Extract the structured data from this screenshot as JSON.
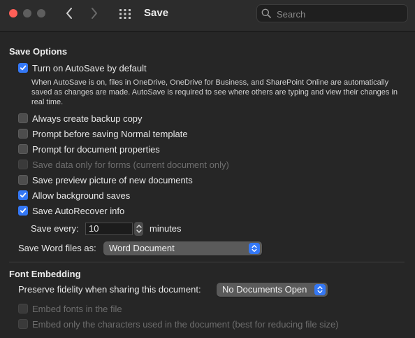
{
  "window": {
    "title": "Save",
    "search_placeholder": "Search"
  },
  "save_options": {
    "heading": "Save Options",
    "autosave": {
      "label": "Turn on AutoSave by default",
      "checked": true,
      "description": "When AutoSave is on, files in OneDrive, OneDrive for Business, and SharePoint Online are automatically saved as changes are made. AutoSave is required to see where others are typing and view their changes in real time."
    },
    "options": [
      {
        "label": "Always create backup copy",
        "checked": false,
        "enabled": true
      },
      {
        "label": "Prompt before saving Normal template",
        "checked": false,
        "enabled": true
      },
      {
        "label": "Prompt for document properties",
        "checked": false,
        "enabled": true
      },
      {
        "label": "Save data only for forms (current document only)",
        "checked": false,
        "enabled": false
      },
      {
        "label": "Save preview picture of new documents",
        "checked": false,
        "enabled": true
      },
      {
        "label": "Allow background saves",
        "checked": true,
        "enabled": true
      },
      {
        "label": "Save AutoRecover info",
        "checked": true,
        "enabled": true
      }
    ],
    "save_every": {
      "label": "Save every:",
      "value": "10",
      "unit": "minutes"
    },
    "file_format": {
      "label": "Save Word files as:",
      "selected": "Word Document"
    }
  },
  "font_embedding": {
    "heading": "Font Embedding",
    "fidelity": {
      "label": "Preserve fidelity when sharing this document:",
      "selected": "No Documents Open"
    },
    "options": [
      {
        "label": "Embed fonts in the file",
        "checked": false,
        "enabled": false
      },
      {
        "label": "Embed only the characters used in the document (best for reducing file size)",
        "checked": false,
        "enabled": false
      }
    ]
  },
  "colors": {
    "accent": "#3478f6",
    "close": "#ff5f57",
    "background": "#262626"
  }
}
